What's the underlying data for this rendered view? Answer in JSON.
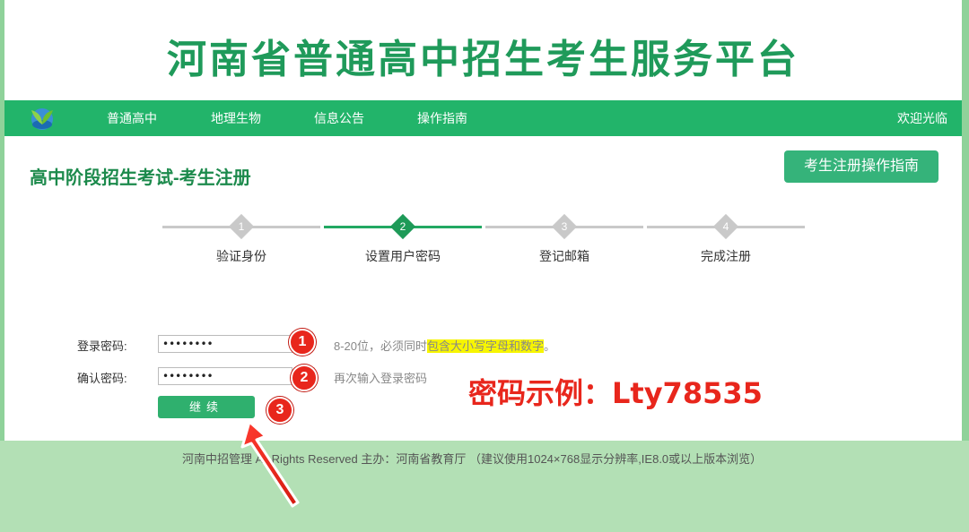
{
  "banner": {
    "title": "河南省普通高中招生考生服务平台"
  },
  "nav": {
    "items": [
      "普通高中",
      "地理生物",
      "信息公告",
      "操作指南"
    ],
    "welcome": "欢迎光临"
  },
  "page": {
    "heading": "高中阶段招生考试-考生注册",
    "guide_button": "考生注册操作指南"
  },
  "steps": [
    {
      "num": "1",
      "label": "验证身份",
      "active": false
    },
    {
      "num": "2",
      "label": "设置用户密码",
      "active": true
    },
    {
      "num": "3",
      "label": "登记邮箱",
      "active": false
    },
    {
      "num": "4",
      "label": "完成注册",
      "active": false
    }
  ],
  "form": {
    "login_password_label": "登录密码:",
    "login_password_value": "••••••••",
    "login_hint_prefix": "8-20位，必须同时",
    "login_hint_highlight": "包含大小写字母和数字",
    "login_hint_suffix": "。",
    "confirm_password_label": "确认密码:",
    "confirm_password_value": "••••••••",
    "confirm_hint": "再次输入登录密码",
    "continue_button": "继续"
  },
  "annotations": {
    "markers": [
      "1",
      "2",
      "3"
    ],
    "example_text": "密码示例：Lty78535"
  },
  "footer": {
    "text": "河南中招管理   All Rights Reserved 主办：河南省教育厅  （建议使用1024×768显示分辨率,IE8.0或以上版本浏览）"
  },
  "colors": {
    "brand_green": "#22b46a",
    "title_green": "#1f9a5a",
    "annotation_red": "#e8261c",
    "highlight_yellow": "#f7f500"
  }
}
